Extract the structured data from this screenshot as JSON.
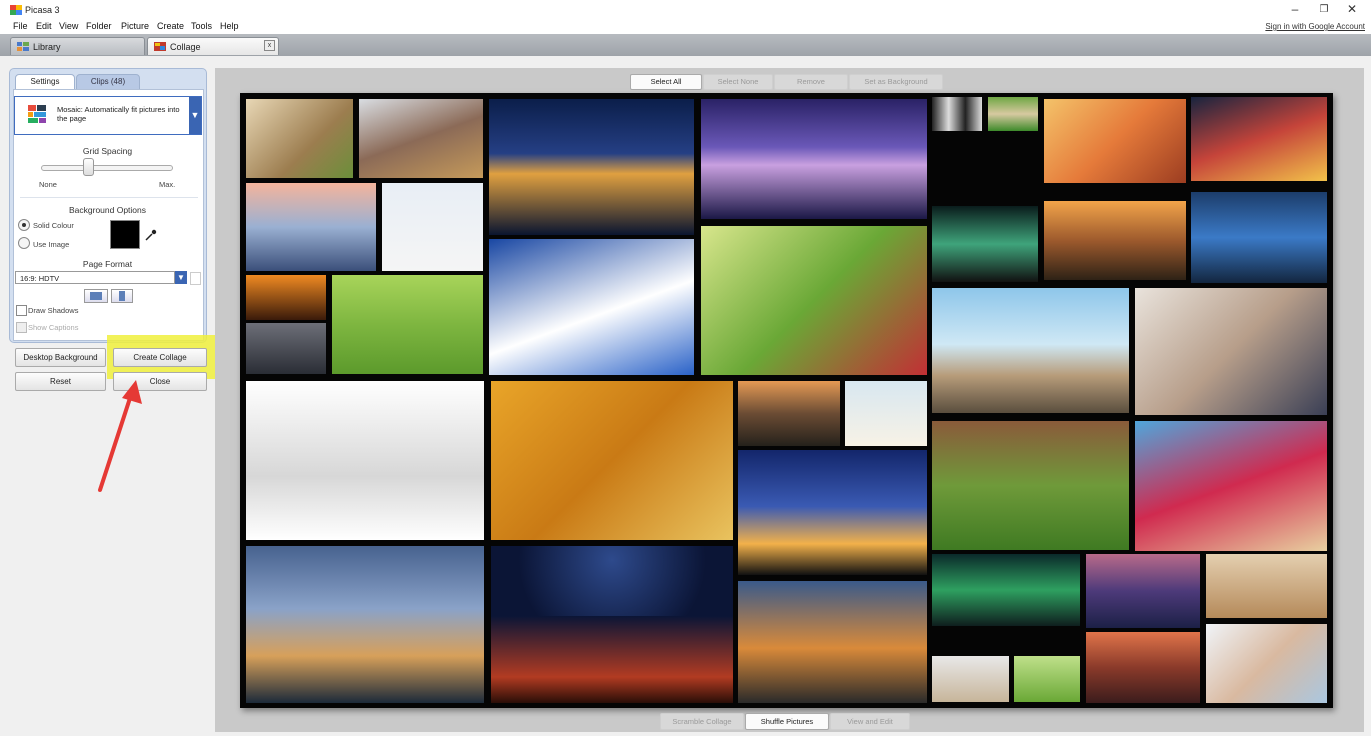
{
  "app": {
    "title": "Picasa 3",
    "signin": "Sign in with Google Account"
  },
  "window_controls": {
    "minimize": "–",
    "restore": "❐",
    "close": "✕"
  },
  "menu": [
    "File",
    "Edit",
    "View",
    "Folder",
    "Picture",
    "Create",
    "Tools",
    "Help"
  ],
  "tabs": {
    "library": "Library",
    "collage": "Collage",
    "close": "x"
  },
  "panel": {
    "settings_tab": "Settings",
    "clips_tab": "Clips (48)",
    "mosaic_text": "Mosaic: Automatically fit pictures into the page",
    "dropdown_arrow": "▼",
    "grid_spacing_label": "Grid Spacing",
    "grid_spacing_min": "None",
    "grid_spacing_max": "Max.",
    "grid_spacing_value": 0.35,
    "background_options_label": "Background Options",
    "solid_colour": "Solid Colour",
    "use_image": "Use Image",
    "solid_colour_selected": true,
    "background_color": "#000000",
    "page_format_label": "Page Format",
    "page_format_value": "16:9: HDTV",
    "draw_shadows": "Draw Shadows",
    "show_captions": "Show Captions"
  },
  "buttons": {
    "desktop_background": "Desktop Background",
    "create_collage": "Create Collage",
    "reset": "Reset",
    "close": "Close"
  },
  "top_toolbar": [
    "Select All",
    "Select None",
    "Remove",
    "Set as Background"
  ],
  "bottom_toolbar": [
    "Scramble Collage",
    "Shuffle Pictures",
    "View and Edit"
  ],
  "colors": {
    "highlight": "#f0f03c",
    "arrow": "#e53935",
    "accent": "#3a65b3"
  },
  "photos": [
    {
      "name": "girl-sunhat",
      "fill": "linear-gradient(135deg,#e8d7b5,#9c7d4f 60%,#6b8f3a)"
    },
    {
      "name": "children-dog-snow",
      "fill": "linear-gradient(160deg,#d9dde2,#8b6a57 50%,#c59a5a)"
    },
    {
      "name": "city-night-1",
      "fill": "linear-gradient(180deg,#0b1e4a,#253f84 40%,#e0a040 55%,#0a1530)"
    },
    {
      "name": "city-night-2",
      "fill": "linear-gradient(180deg,#2a2266,#6a58b8 40%,#c9a0e0 55%,#1b1846)"
    },
    {
      "name": "husky",
      "fill": "linear-gradient(90deg,#222,#ddd,#222,#ddd)"
    },
    {
      "name": "child-field",
      "fill": "linear-gradient(180deg,#6fa744,#d7c9a0,#3d8a2a)"
    },
    {
      "name": "girl-leaves",
      "fill": "linear-gradient(135deg,#f4c36a,#e57a3a,#9c3d21)"
    },
    {
      "name": "times-square",
      "fill": "linear-gradient(160deg,#18243f,#c5443a,#f2c24a)"
    },
    {
      "name": "couple-dock",
      "fill": "linear-gradient(180deg,#f4b49c,#9ab0d2,#3b4f7a)"
    },
    {
      "name": "dogs-snow",
      "fill": "linear-gradient(180deg,#e8eef5,#f5f5f5)"
    },
    {
      "name": "santorini",
      "fill": "linear-gradient(160deg,#1947a3,#ffffff 55%,#2a62c8)"
    },
    {
      "name": "kids-hug",
      "fill": "linear-gradient(135deg,#d8e68c,#6aa836,#c22f35)"
    },
    {
      "name": "aurora-1",
      "fill": "linear-gradient(180deg,#0a1c1c,#3fa47b,#111)"
    },
    {
      "name": "junk-boat",
      "fill": "linear-gradient(180deg,#f2a44a,#9d5a2d,#2e2216)"
    },
    {
      "name": "rain-boy",
      "fill": "linear-gradient(180deg,#1c3d6b,#3b7ac7,#13263f)"
    },
    {
      "name": "silhouette-sunset",
      "fill": "linear-gradient(180deg,#f08a22,#3a1a0a)"
    },
    {
      "name": "boy-upside-down",
      "fill": "linear-gradient(180deg,#a8d45a,#7eb640,#5c9a2c)"
    },
    {
      "name": "pier-beach",
      "fill": "linear-gradient(180deg,#8ec6ea,#cfe8f5 45%,#b79c7a 70%,#5a4e3e)"
    },
    {
      "name": "baby-scarf",
      "fill": "linear-gradient(135deg,#e9e3dc,#b79e8a,#3a3f55)"
    },
    {
      "name": "storm-rocks",
      "fill": "linear-gradient(180deg,#6d6f78,#2a2d35)"
    },
    {
      "name": "kittens",
      "fill": "linear-gradient(180deg,#ffffff,#d7d7d7 60%,#ffffff)"
    },
    {
      "name": "girl-yellow-leaf",
      "fill": "linear-gradient(135deg,#e9a529,#c97a15,#e9c35f)"
    },
    {
      "name": "road-sunset",
      "fill": "linear-gradient(180deg,#e59a54,#6b4c34,#25211b)"
    },
    {
      "name": "boy-suitcase",
      "fill": "linear-gradient(180deg,#d8e7f0,#f7f2e6)"
    },
    {
      "name": "girl-grass",
      "fill": "linear-gradient(180deg,#8a5a3a,#6f9a3a,#3f7a22)"
    },
    {
      "name": "dog-hammock",
      "fill": "linear-gradient(160deg,#4fa6dc,#d02a4f 50%,#e8d0a0)"
    },
    {
      "name": "louvre",
      "fill": "linear-gradient(180deg,#13266b,#3a5ab3 45%,#f2b14a 75%,#111)"
    },
    {
      "name": "tower-bridge",
      "fill": "linear-gradient(180deg,#47628f,#8aa2c8 40%,#d7a05a 70%,#1c2a3a)"
    },
    {
      "name": "star-trails",
      "fill": "radial-gradient(circle at 50% 20%,#2e4a8c,#0b1536 70%)"
    },
    {
      "name": "red-mountain",
      "fill": "linear-gradient(180deg,#0b1536,#b23b22 70%,#2a0e08)"
    },
    {
      "name": "eiffel",
      "fill": "linear-gradient(180deg,#3a5a8a,#d98a3a 55%,#2a2a2a)"
    },
    {
      "name": "aurora-2",
      "fill": "linear-gradient(180deg,#0a2a2a,#2ea060,#0f1e1e)"
    },
    {
      "name": "purple-sea",
      "fill": "linear-gradient(180deg,#b86a8a,#4d3a7a,#1c2046)"
    },
    {
      "name": "horses",
      "fill": "linear-gradient(180deg,#e4cfb0,#b58a5a)"
    },
    {
      "name": "cat-white",
      "fill": "linear-gradient(180deg,#e8e8e8,#c7b59a)"
    },
    {
      "name": "puppy-grass",
      "fill": "linear-gradient(180deg,#bfe08a,#6aa836)"
    },
    {
      "name": "sunset-lake",
      "fill": "linear-gradient(180deg,#e0744a,#8a3a2a,#3b1c1c)"
    },
    {
      "name": "baby-hood",
      "fill": "linear-gradient(135deg,#f0f4f8,#d9b9a0,#aac7e0)"
    }
  ]
}
